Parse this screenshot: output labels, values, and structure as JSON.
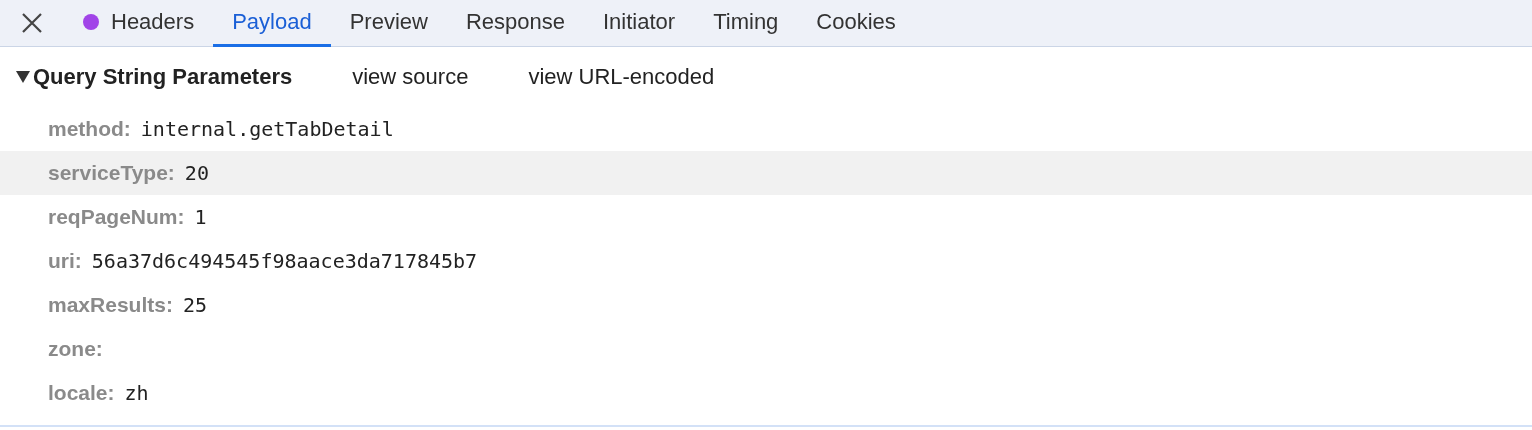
{
  "tabs": [
    {
      "label": "Headers",
      "selected": false,
      "dot": true,
      "color": "#a144e8"
    },
    {
      "label": "Payload",
      "selected": true,
      "dot": false
    },
    {
      "label": "Preview",
      "selected": false,
      "dot": false
    },
    {
      "label": "Response",
      "selected": false,
      "dot": false
    },
    {
      "label": "Initiator",
      "selected": false,
      "dot": false
    },
    {
      "label": "Timing",
      "selected": false,
      "dot": false
    },
    {
      "label": "Cookies",
      "selected": false,
      "dot": false
    }
  ],
  "section": {
    "title": "Query String Parameters",
    "expanded": true,
    "links": [
      "view source",
      "view URL-encoded"
    ]
  },
  "params": [
    {
      "key": "method:",
      "value": "internal.getTabDetail",
      "selected": false
    },
    {
      "key": "serviceType:",
      "value": "20",
      "selected": true
    },
    {
      "key": "reqPageNum:",
      "value": "1",
      "selected": false
    },
    {
      "key": "uri:",
      "value": "56a37d6c494545f98aace3da717845b7",
      "selected": false
    },
    {
      "key": "maxResults:",
      "value": "25",
      "selected": false
    },
    {
      "key": "zone:",
      "selected": false
    },
    {
      "key": "locale:",
      "value": "zh",
      "selected": false
    }
  ]
}
